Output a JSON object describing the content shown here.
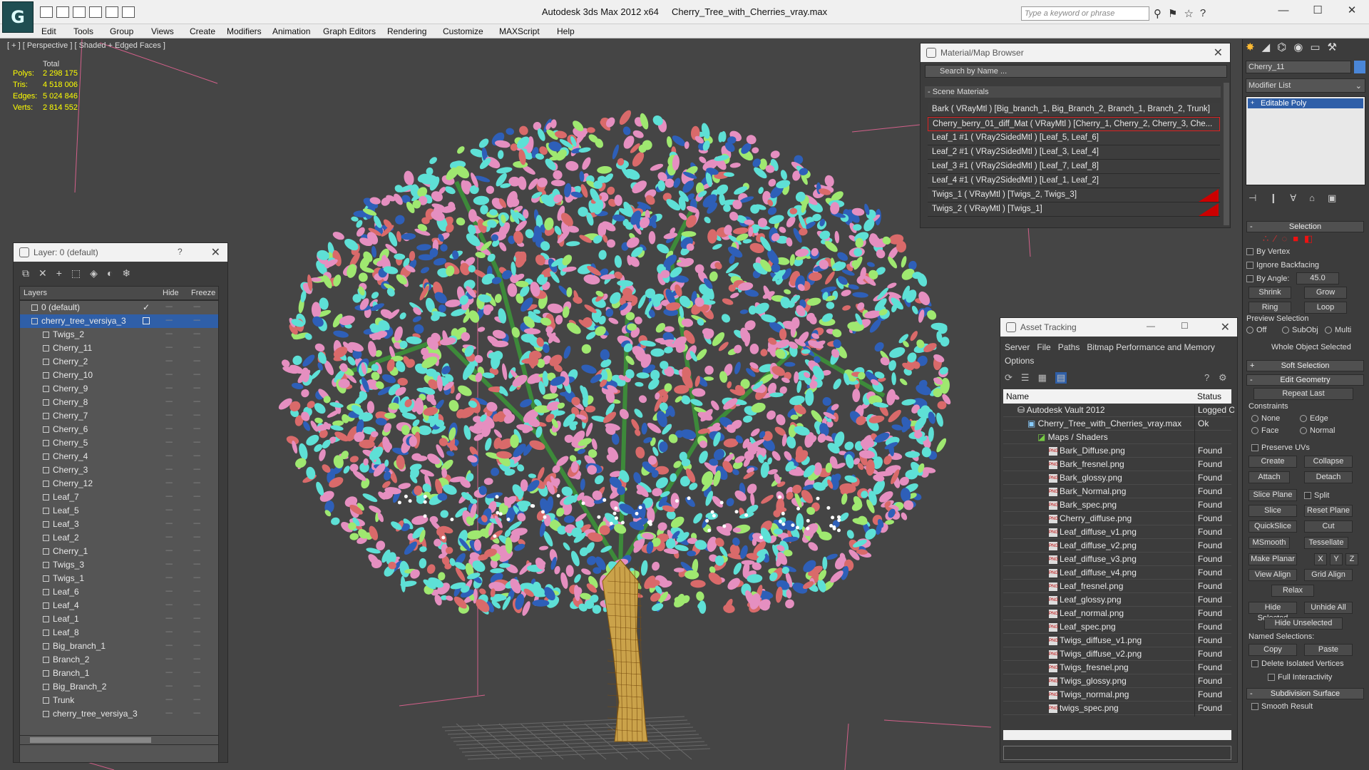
{
  "window": {
    "app_title": "Autodesk 3ds Max  2012 x64",
    "file_title": "Cherry_Tree_with_Cherries_vray.max",
    "search_placeholder": "Type a keyword or phrase",
    "minimize": "—",
    "maximize": "☐",
    "close": "✕"
  },
  "menu": [
    "Edit",
    "Tools",
    "Group",
    "Views",
    "Create",
    "Modifiers",
    "Animation",
    "Graph Editors",
    "Rendering",
    "Customize",
    "MAXScript",
    "Help"
  ],
  "viewport": {
    "label": "[ + ] [ Perspective ] [ Shaded + Edged Faces ]",
    "stats": {
      "header": "Total",
      "polys_label": "Polys:",
      "polys": "2 298 175",
      "tris_label": "Tris:",
      "tris": "4 518 006",
      "edges_label": "Edges:",
      "edges": "5 024 846",
      "verts_label": "Verts:",
      "verts": "2 814 552"
    }
  },
  "layer_panel": {
    "title": "Layer: 0 (default)",
    "help": "?",
    "close": "✕",
    "col_layers": "Layers",
    "col_hide": "Hide",
    "col_freeze": "Freeze",
    "layers": [
      "0 (default)",
      "cherry_tree_versiya_3",
      "Twigs_2",
      "Cherry_11",
      "Cherry_2",
      "Cherry_10",
      "Cherry_9",
      "Cherry_8",
      "Cherry_7",
      "Cherry_6",
      "Cherry_5",
      "Cherry_4",
      "Cherry_3",
      "Cherry_12",
      "Leaf_7",
      "Leaf_5",
      "Leaf_3",
      "Leaf_2",
      "Cherry_1",
      "Twigs_3",
      "Twigs_1",
      "Leaf_6",
      "Leaf_4",
      "Leaf_1",
      "Leaf_8",
      "Big_branch_1",
      "Branch_2",
      "Branch_1",
      "Big_Branch_2",
      "Trunk",
      "cherry_tree_versiya_3"
    ],
    "hide_mark": "----",
    "check": "✓"
  },
  "material_browser": {
    "title": "Material/Map Browser",
    "close": "✕",
    "search": "Search by Name ...",
    "section": "- Scene Materials",
    "materials": [
      "Bark  ( VRayMtl )  [Big_branch_1, Big_Branch_2, Branch_1, Branch_2, Trunk]",
      "Cherry_berry_01_diff_Mat  ( VRayMtl )  [Cherry_1, Cherry_2, Cherry_3, Che...",
      "Leaf_1 #1  ( VRay2SidedMtl )  [Leaf_5, Leaf_6]",
      "Leaf_2 #1  ( VRay2SidedMtl )  [Leaf_3, Leaf_4]",
      "Leaf_3 #1  ( VRay2SidedMtl )  [Leaf_7, Leaf_8]",
      "Leaf_4 #1  ( VRay2SidedMtl )  [Leaf_1, Leaf_2]",
      "Twigs_1  ( VRayMtl )  [Twigs_2, Twigs_3]",
      "Twigs_2  ( VRayMtl )  [Twigs_1]"
    ]
  },
  "asset_tracking": {
    "title": "Asset Tracking",
    "min": "—",
    "max": "☐",
    "close": "✕",
    "menu": [
      "Server",
      "File",
      "Paths",
      "Bitmap Performance and Memory",
      "Options"
    ],
    "col_name": "Name",
    "col_status": "Status",
    "vault": "Autodesk Vault 2012",
    "vault_status": "Logged O",
    "file": "Cherry_Tree_with_Cherries_vray.max",
    "file_status": "Ok",
    "maps": "Maps / Shaders",
    "assets": [
      "Bark_Diffuse.png",
      "Bark_fresnel.png",
      "Bark_glossy.png",
      "Bark_Normal.png",
      "Bark_spec.png",
      "Cherry_diffuse.png",
      "Leaf_diffuse_v1.png",
      "Leaf_diffuse_v2.png",
      "Leaf_diffuse_v3.png",
      "Leaf_diffuse_v4.png",
      "Leaf_fresnel.png",
      "Leaf_glossy.png",
      "Leaf_normal.png",
      "Leaf_spec.png",
      "Twigs_diffuse_v1.png",
      "Twigs_diffuse_v2.png",
      "Twigs_fresnel.png",
      "Twigs_glossy.png",
      "Twigs_normal.png",
      "twigs_spec.png"
    ],
    "found": "Found",
    "png": "PNG"
  },
  "command_panel": {
    "object_name": "Cherry_11",
    "modifier_list": "Modifier List",
    "modifier": "Editable Poly",
    "selection": "Selection",
    "by_vertex": "By Vertex",
    "ignore_backfacing": "Ignore Backfacing",
    "by_angle": "By Angle:",
    "angle": "45.0",
    "shrink": "Shrink",
    "grow": "Grow",
    "ring": "Ring",
    "loop": "Loop",
    "preview_selection": "Preview Selection",
    "off": "Off",
    "subobj": "SubObj",
    "multi": "Multi",
    "whole_object": "Whole Object Selected",
    "soft_selection": "Soft Selection",
    "edit_geometry": "Edit Geometry",
    "repeat_last": "Repeat Last",
    "constraints": "Constraints",
    "none": "None",
    "edge": "Edge",
    "face": "Face",
    "normal": "Normal",
    "preserve_uvs": "Preserve UVs",
    "create": "Create",
    "collapse": "Collapse",
    "attach": "Attach",
    "detach": "Detach",
    "slice_plane": "Slice Plane",
    "split": "Split",
    "slice": "Slice",
    "reset_plane": "Reset Plane",
    "quickslice": "QuickSlice",
    "cut": "Cut",
    "msmooth": "MSmooth",
    "tessellate": "Tessellate",
    "make_planar": "Make Planar",
    "x": "X",
    "y": "Y",
    "z": "Z",
    "view_align": "View Align",
    "grid_align": "Grid Align",
    "relax": "Relax",
    "hide_selected": "Hide Selected",
    "unhide_all": "Unhide All",
    "hide_unselected": "Hide Unselected",
    "named_selections": "Named Selections:",
    "copy": "Copy",
    "paste": "Paste",
    "delete_isolated": "Delete Isolated Vertices",
    "full_interactivity": "Full Interactivity",
    "subdivision_surface": "Subdivision Surface",
    "smooth_result": "Smooth Result",
    "plus": "+",
    "minus": "-"
  },
  "colors": {
    "leaf_pink": "#e58fc0",
    "leaf_cyan": "#5ee0d6",
    "leaf_green": "#9fe870",
    "cherry_blue": "#2e5fb8",
    "leaf_red": "#d96a6a",
    "trunk": "#c98a1e",
    "selection_blue": "#2f5fa8"
  }
}
